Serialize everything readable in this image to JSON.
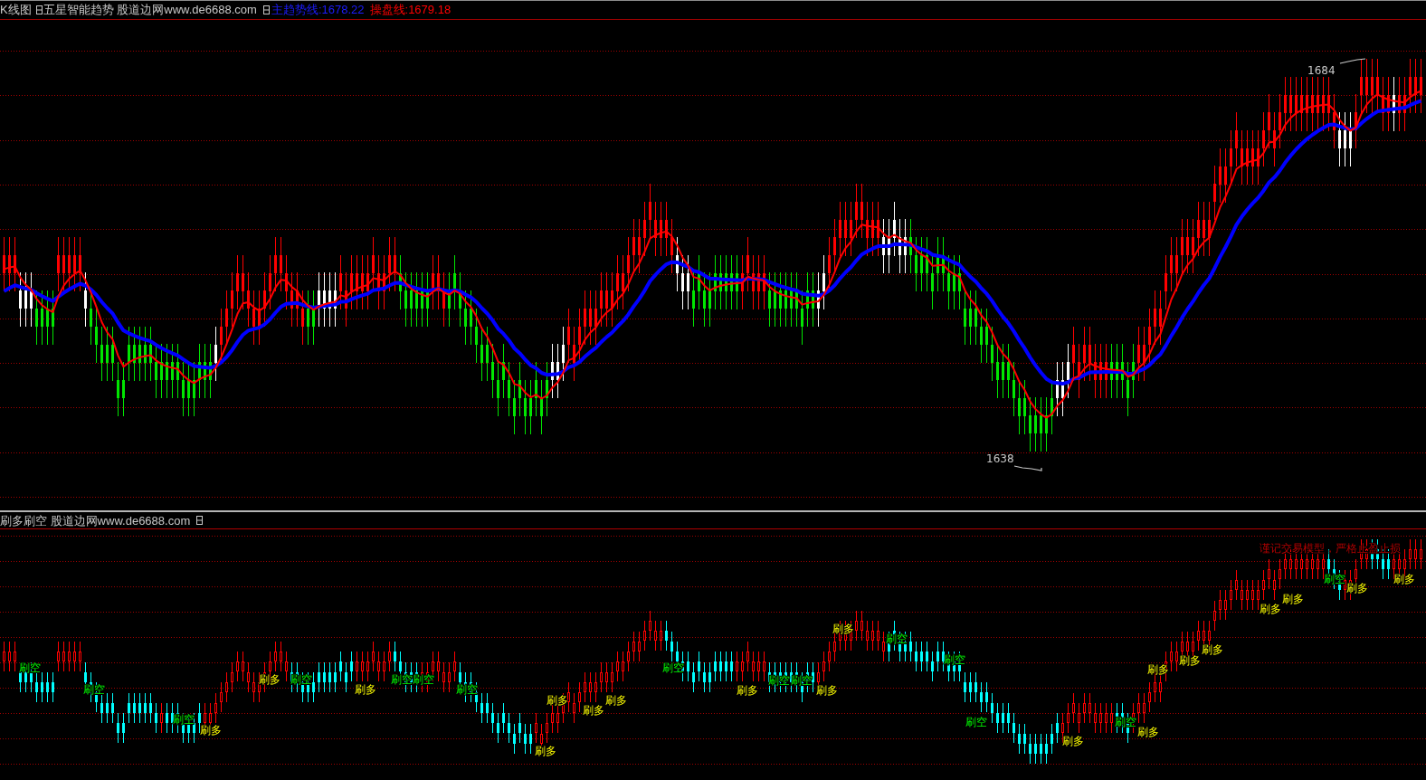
{
  "main_panel": {
    "title": {
      "chart_name": "K线图",
      "indicator_name": "五星智能趋势 股道边网www.de6688.com",
      "readings": [
        {
          "label": "主趋势线:1678.22",
          "kind": "trend"
        },
        {
          "label": "操盘线:1679.18",
          "kind": "trade"
        }
      ]
    },
    "price_labels": [
      {
        "text": "1684",
        "kind": "high"
      },
      {
        "text": "1638",
        "kind": "low"
      }
    ]
  },
  "sub_panel": {
    "title": {
      "indicator_name": "刷多刷空 股道边网www.de6688.com"
    },
    "note": "谨记交易模型，严格止盈止损",
    "signals": [
      {
        "text": "刷空",
        "kind": "short"
      },
      {
        "text": "刷空",
        "kind": "short"
      },
      {
        "text": "刷空",
        "kind": "short"
      },
      {
        "text": "刷多",
        "kind": "long"
      },
      {
        "text": "刷多",
        "kind": "long"
      },
      {
        "text": "刷空",
        "kind": "short"
      },
      {
        "text": "刷多",
        "kind": "long"
      },
      {
        "text": "刷空",
        "kind": "short"
      },
      {
        "text": "刷空",
        "kind": "short"
      },
      {
        "text": "刷空",
        "kind": "short"
      },
      {
        "text": "刷多",
        "kind": "long"
      },
      {
        "text": "刷多",
        "kind": "long"
      },
      {
        "text": "刷多",
        "kind": "long"
      },
      {
        "text": "刷多",
        "kind": "long"
      },
      {
        "text": "刷空",
        "kind": "short"
      },
      {
        "text": "刷多",
        "kind": "long"
      },
      {
        "text": "刷空",
        "kind": "short"
      },
      {
        "text": "刷空",
        "kind": "short"
      },
      {
        "text": "刷多",
        "kind": "long"
      },
      {
        "text": "刷多",
        "kind": "long"
      },
      {
        "text": "刷空",
        "kind": "short"
      },
      {
        "text": "刷空",
        "kind": "short"
      },
      {
        "text": "刷空",
        "kind": "short"
      },
      {
        "text": "刷多",
        "kind": "long"
      },
      {
        "text": "刷空",
        "kind": "short"
      },
      {
        "text": "刷多",
        "kind": "long"
      },
      {
        "text": "刷多",
        "kind": "long"
      },
      {
        "text": "刷多",
        "kind": "long"
      },
      {
        "text": "刷多",
        "kind": "long"
      },
      {
        "text": "刷多",
        "kind": "long"
      },
      {
        "text": "刷多",
        "kind": "long"
      },
      {
        "text": "刷空",
        "kind": "short"
      },
      {
        "text": "刷多",
        "kind": "long"
      },
      {
        "text": "刷多",
        "kind": "long"
      }
    ]
  }
}
